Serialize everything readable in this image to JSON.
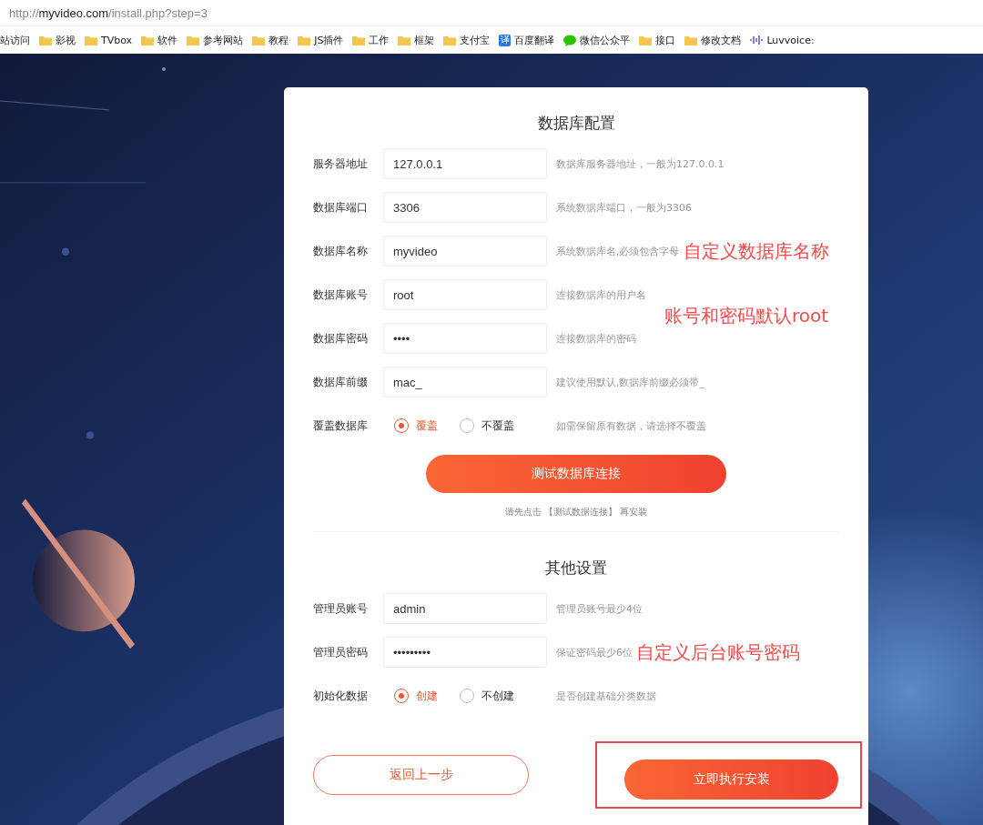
{
  "address_bar": {
    "scheme": "http://",
    "host": "myvideo.com",
    "path": "/install.php?step=3"
  },
  "bookmarks": [
    {
      "kind": "plain",
      "label": "站访问"
    },
    {
      "kind": "folder",
      "label": "影视"
    },
    {
      "kind": "folder",
      "label": "TVbox"
    },
    {
      "kind": "folder",
      "label": "软件"
    },
    {
      "kind": "folder",
      "label": "参考网站"
    },
    {
      "kind": "folder",
      "label": "教程"
    },
    {
      "kind": "folder",
      "label": "JS插件"
    },
    {
      "kind": "folder",
      "label": "工作"
    },
    {
      "kind": "folder",
      "label": "框架"
    },
    {
      "kind": "folder",
      "label": "支付宝"
    },
    {
      "kind": "translate",
      "glyph": "译",
      "label": "百度翻译"
    },
    {
      "kind": "chat",
      "label": "微信公众平"
    },
    {
      "kind": "folder",
      "label": "接口"
    },
    {
      "kind": "folder",
      "label": "修改文档"
    },
    {
      "kind": "wave",
      "label": "Luvvoice:"
    }
  ],
  "sections": [
    {
      "title": "数据库配置",
      "fields": [
        {
          "kind": "text",
          "label": "服务器地址",
          "value": "127.0.0.1",
          "hint": "数据库服务器地址，一般为127.0.0.1"
        },
        {
          "kind": "text",
          "label": "数据库端口",
          "value": "3306",
          "hint": "系统数据库端口，一般为3306"
        },
        {
          "kind": "text",
          "label": "数据库名称",
          "value": "myvideo",
          "hint": "系统数据库名,必须包含字母",
          "annotation": {
            "kind": "inline",
            "text": "自定义数据库名称"
          }
        },
        {
          "kind": "text",
          "label": "数据库账号",
          "value": "root",
          "hint": "连接数据库的用户名",
          "annotation": {
            "kind": "below",
            "text": "账号和密码默认root"
          }
        },
        {
          "kind": "text",
          "label": "数据库密码",
          "value": "••••",
          "hint": "连接数据库的密码"
        },
        {
          "kind": "text",
          "label": "数据库前缀",
          "value": "mac_",
          "hint": "建议使用默认,数据库前缀必须带_"
        },
        {
          "kind": "radio",
          "label": "覆盖数据库",
          "options": [
            {
              "label": "覆盖",
              "selected": true
            },
            {
              "label": "不覆盖",
              "selected": false
            }
          ],
          "hint": "如需保留原有数据，请选择不覆盖"
        }
      ],
      "action": "测试数据库连接",
      "note": "请先点击 【测试数据连接】 再安装"
    },
    {
      "title": "其他设置",
      "fields": [
        {
          "kind": "text",
          "label": "管理员账号",
          "value": "admin",
          "hint": "管理员账号最少4位"
        },
        {
          "kind": "text",
          "label": "管理员密码",
          "value": "•••••••••",
          "hint": "保证密码最少6位",
          "annotation": {
            "kind": "inline",
            "text": "自定义后台账号密码"
          }
        },
        {
          "kind": "radio",
          "label": "初始化数据",
          "options": [
            {
              "label": "创建",
              "selected": true
            },
            {
              "label": "不创建",
              "selected": false
            }
          ],
          "hint": "是否创建基础分类数据"
        }
      ]
    }
  ],
  "footer": {
    "back": "返回上一步",
    "install": "立即执行安装",
    "install_highlighted": true
  }
}
